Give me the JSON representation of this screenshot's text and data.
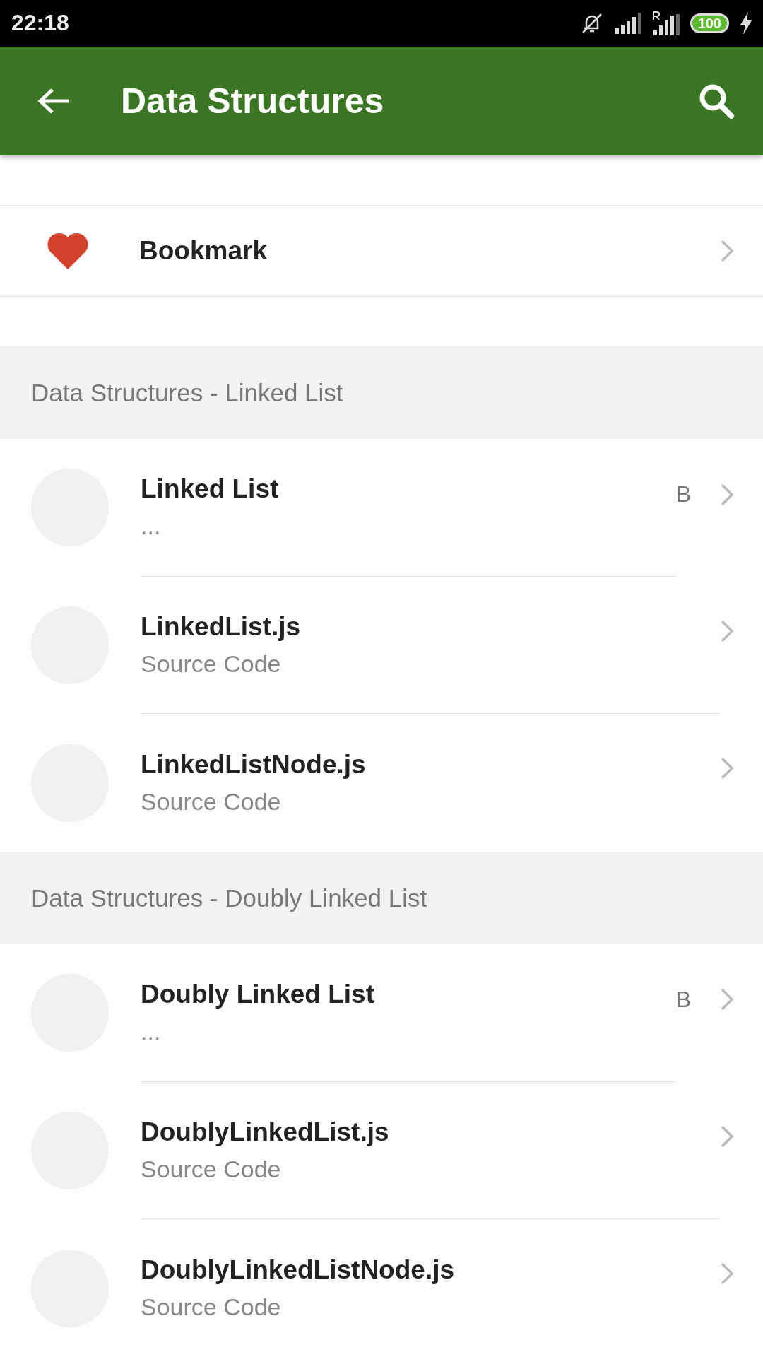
{
  "status_bar": {
    "time": "22:18",
    "battery": "100"
  },
  "app_bar": {
    "title": "Data Structures"
  },
  "bookmark": {
    "label": "Bookmark"
  },
  "sections": [
    {
      "title": "Data Structures - Linked List",
      "items": [
        {
          "title": "Linked List",
          "subtitle": "...",
          "badge": "B"
        },
        {
          "title": "LinkedList.js",
          "subtitle": "Source Code"
        },
        {
          "title": "LinkedListNode.js",
          "subtitle": "Source Code"
        }
      ]
    },
    {
      "title": "Data Structures - Doubly Linked List",
      "items": [
        {
          "title": "Doubly Linked List",
          "subtitle": "...",
          "badge": "B"
        },
        {
          "title": "DoublyLinkedList.js",
          "subtitle": "Source Code"
        },
        {
          "title": "DoublyLinkedListNode.js",
          "subtitle": "Source Code"
        }
      ]
    }
  ]
}
